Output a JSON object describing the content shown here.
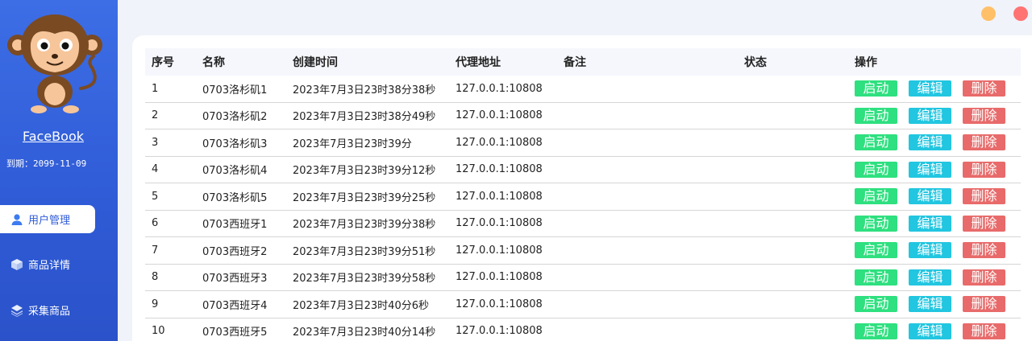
{
  "sidebar": {
    "app_name": "FaceBook",
    "expiry": "到期：2099-11-09",
    "nav": [
      {
        "label": "用户管理",
        "icon": "user-icon",
        "active": true
      },
      {
        "label": "商品详情",
        "icon": "cube-icon",
        "active": false
      },
      {
        "label": "采集商品",
        "icon": "layers-icon",
        "active": false
      }
    ]
  },
  "window": {
    "minimize_color": "#ffc069",
    "close_color": "#ff7373"
  },
  "table": {
    "headers": {
      "no": "序号",
      "name": "名称",
      "created": "创建时间",
      "proxy": "代理地址",
      "note": "备注",
      "status": "状态",
      "ops": "操作"
    },
    "actions": {
      "start": "启动",
      "edit": "编辑",
      "delete": "删除"
    },
    "rows": [
      {
        "no": "1",
        "name": "0703洛杉矶1",
        "created": "2023年7月3日23时38分38秒",
        "proxy": "127.0.0.1:10808",
        "note": "",
        "status": ""
      },
      {
        "no": "2",
        "name": "0703洛杉矶2",
        "created": "2023年7月3日23时38分49秒",
        "proxy": "127.0.0.1:10808",
        "note": "",
        "status": ""
      },
      {
        "no": "3",
        "name": "0703洛杉矶3",
        "created": "2023年7月3日23时39分",
        "proxy": "127.0.0.1:10808",
        "note": "",
        "status": ""
      },
      {
        "no": "4",
        "name": "0703洛杉矶4",
        "created": "2023年7月3日23时39分12秒",
        "proxy": "127.0.0.1:10808",
        "note": "",
        "status": ""
      },
      {
        "no": "5",
        "name": "0703洛杉矶5",
        "created": "2023年7月3日23时39分25秒",
        "proxy": "127.0.0.1:10808",
        "note": "",
        "status": ""
      },
      {
        "no": "6",
        "name": "0703西班牙1",
        "created": "2023年7月3日23时39分38秒",
        "proxy": "127.0.0.1:10808",
        "note": "",
        "status": ""
      },
      {
        "no": "7",
        "name": "0703西班牙2",
        "created": "2023年7月3日23时39分51秒",
        "proxy": "127.0.0.1:10808",
        "note": "",
        "status": ""
      },
      {
        "no": "8",
        "name": "0703西班牙3",
        "created": "2023年7月3日23时39分58秒",
        "proxy": "127.0.0.1:10808",
        "note": "",
        "status": ""
      },
      {
        "no": "9",
        "name": "0703西班牙4",
        "created": "2023年7月3日23时40分6秒",
        "proxy": "127.0.0.1:10808",
        "note": "",
        "status": ""
      },
      {
        "no": "10",
        "name": "0703西班牙5",
        "created": "2023年7月3日23时40分14秒",
        "proxy": "127.0.0.1:10808",
        "note": "",
        "status": ""
      }
    ]
  }
}
